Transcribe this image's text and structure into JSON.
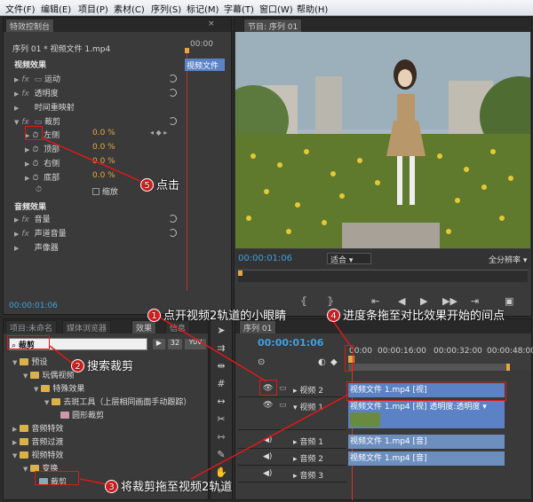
{
  "menu": [
    "文件(F)",
    "编辑(E)",
    "项目(P)",
    "素材(C)",
    "序列(S)",
    "标记(M)",
    "字幕(T)",
    "窗口(W)",
    "帮助(H)"
  ],
  "effect_controls": {
    "tab": "特效控制台",
    "tab_x": "×",
    "source": "序列 01 * 视频文件 1.mp4",
    "timecode_top": "00:00",
    "clip_label": "视频文件",
    "video_effects": "视频效果",
    "motion": "运动",
    "opacity": "透明度",
    "time_remap": "时间重映射",
    "crop": "裁剪",
    "left": "左侧",
    "top": "顶部",
    "right": "右侧",
    "bottom": "底部",
    "left_val": "0.0 %",
    "top_val": "0.0 %",
    "right_val": "0.0 %",
    "bottom_val": "0.0 %",
    "zoom": "缩放",
    "audio_effects": "音频效果",
    "volume": "音量",
    "channel_volume": "声道音量",
    "panner": "声像器",
    "timecode": "00:00:01:06"
  },
  "program": {
    "tab": "节目: 序列 01",
    "timecode": "00:00:01:06",
    "fit": "适合",
    "full": "全分辨率"
  },
  "project": {
    "tabs": [
      "项目:未命名",
      "媒体浏览器",
      "效果",
      "信息"
    ],
    "search": "裁剪",
    "badges": [
      "32",
      "YUV"
    ],
    "tree": [
      "预设",
      "玩偶视频",
      "特殊效果",
      "去斑工具（上层相同画面手动跟踪）",
      "圆形裁剪",
      "音频特效",
      "音频过渡",
      "视频特效",
      "变换",
      "裁剪"
    ]
  },
  "timeline": {
    "tab": "序列 01",
    "timecode": "00:00:01:06",
    "ruler": [
      "00:00",
      "00:00:16:00",
      "00:00:32:00",
      "00:00:48:00"
    ],
    "tracks": [
      "视频 2",
      "视频 1",
      "音频 1",
      "音频 2",
      "音频 3"
    ],
    "clip_v2": "视频文件 1.mp4 [视]",
    "clip_v1": "视频文件 1.mp4 [视]  透明度:透明度 ▾",
    "clip_a1": "视频文件 1.mp4 [音]",
    "clip_a2": "视频文件 1.mp4 [音]"
  },
  "annotations": {
    "a1": "点开视频2轨道的小眼睛",
    "a2": "搜索裁剪",
    "a3": "将裁剪拖至视频2轨道",
    "a4": "进度条拖至对比效果开始的间点",
    "a5": "点击",
    "n1": "1",
    "n2": "2",
    "n3": "3",
    "n4": "4",
    "n5": "5"
  },
  "colors": {
    "accent": "#e8a640",
    "callout_red": "#d71f1f",
    "clip_blue": "#5b82c4"
  }
}
